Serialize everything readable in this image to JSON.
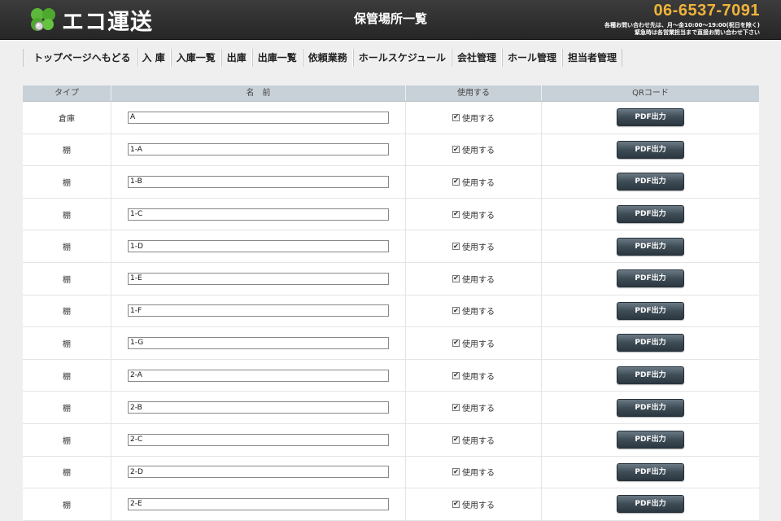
{
  "header": {
    "logo_text": "エコ運送",
    "title": "保管場所一覧",
    "phone": "06-6537-7091",
    "note_line1": "各種お問い合わせ先は、月〜金10:00〜19:00(祝日を除く)",
    "note_line2": "緊急時は各営業担当まで直接お問い合わせ下さい"
  },
  "nav": {
    "items": [
      {
        "label": "トップページへもどる"
      },
      {
        "label": "入 庫"
      },
      {
        "label": "入庫一覧"
      },
      {
        "label": "出庫"
      },
      {
        "label": "出庫一覧"
      },
      {
        "label": "依頼業務"
      },
      {
        "label": "ホールスケジュール"
      },
      {
        "label": "会社管理"
      },
      {
        "label": "ホール管理"
      },
      {
        "label": "担当者管理"
      }
    ]
  },
  "table": {
    "headers": {
      "type": "タイプ",
      "name": "名　前",
      "use": "使用する",
      "qr": "QRコード"
    },
    "rows": [
      {
        "type": "倉庫",
        "name": "A",
        "use_label": "使用する",
        "checked": true,
        "btn": "PDF出力"
      },
      {
        "type": "棚",
        "name": "1-A",
        "use_label": "使用する",
        "checked": true,
        "btn": "PDF出力"
      },
      {
        "type": "棚",
        "name": "1-B",
        "use_label": "使用する",
        "checked": true,
        "btn": "PDF出力"
      },
      {
        "type": "棚",
        "name": "1-C",
        "use_label": "使用する",
        "checked": true,
        "btn": "PDF出力"
      },
      {
        "type": "棚",
        "name": "1-D",
        "use_label": "使用する",
        "checked": true,
        "btn": "PDF出力"
      },
      {
        "type": "棚",
        "name": "1-E",
        "use_label": "使用する",
        "checked": true,
        "btn": "PDF出力"
      },
      {
        "type": "棚",
        "name": "1-F",
        "use_label": "使用する",
        "checked": true,
        "btn": "PDF出力"
      },
      {
        "type": "棚",
        "name": "1-G",
        "use_label": "使用する",
        "checked": true,
        "btn": "PDF出力"
      },
      {
        "type": "棚",
        "name": "2-A",
        "use_label": "使用する",
        "checked": true,
        "btn": "PDF出力"
      },
      {
        "type": "棚",
        "name": "2-B",
        "use_label": "使用する",
        "checked": true,
        "btn": "PDF出力"
      },
      {
        "type": "棚",
        "name": "2-C",
        "use_label": "使用する",
        "checked": true,
        "btn": "PDF出力"
      },
      {
        "type": "棚",
        "name": "2-D",
        "use_label": "使用する",
        "checked": true,
        "btn": "PDF出力"
      },
      {
        "type": "棚",
        "name": "2-E",
        "use_label": "使用する",
        "checked": true,
        "btn": "PDF出力"
      }
    ]
  },
  "colors": {
    "header_bg": "#2e2e2e",
    "phone": "#f0b43a",
    "table_header_bg": "#c9d1d8",
    "button_bg": "#3e4c56"
  }
}
